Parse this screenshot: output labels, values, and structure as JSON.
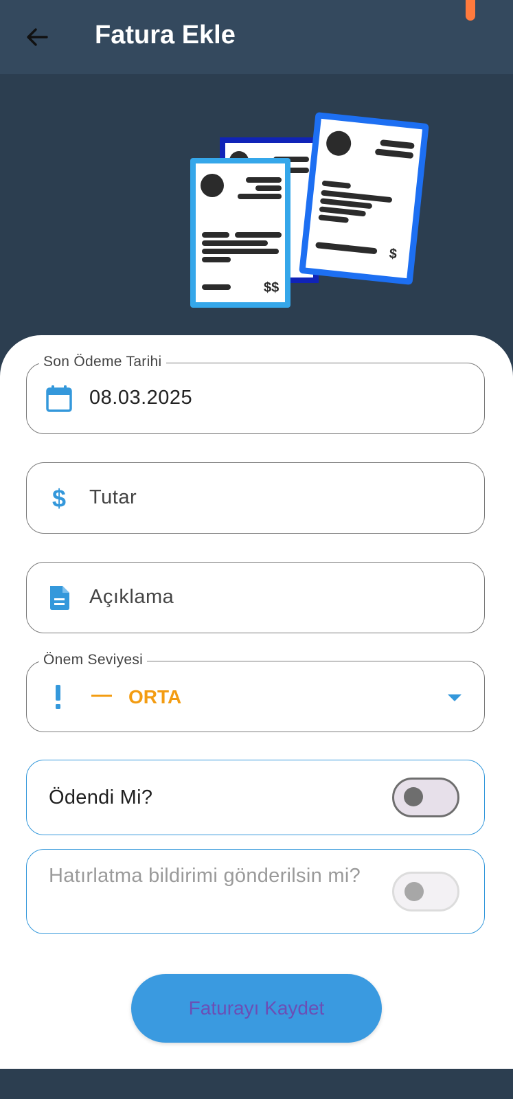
{
  "appbar": {
    "title": "Fatura Ekle",
    "back_icon": "arrow-left-icon"
  },
  "illustration": {
    "back_card_symbol": "$$",
    "left_card_symbol": "$$",
    "right_card_symbol": "$"
  },
  "form": {
    "due_date": {
      "label": "Son Ödeme Tarihi",
      "value": "08.03.2025",
      "icon": "calendar-icon"
    },
    "amount": {
      "placeholder": "Tutar",
      "icon": "dollar-icon"
    },
    "description": {
      "placeholder": "Açıklama",
      "icon": "document-icon"
    },
    "priority": {
      "label": "Önem Seviyesi",
      "value": "ORTA",
      "value_color": "#f39c12",
      "icon": "exclamation-icon",
      "marker": "—",
      "dropdown_icon": "dropdown-arrow-icon"
    },
    "paid": {
      "label": "Ödendi Mi?",
      "on": false
    },
    "reminder": {
      "label": "Hatırlatma bildirimi gönderilsin mi?",
      "on": false,
      "enabled": false
    }
  },
  "save_button": {
    "label": "Faturayı Kaydet"
  },
  "colors": {
    "appbar": "#34495e",
    "background": "#2c3e50",
    "accent": "#3498db",
    "priority_orange": "#f39c12"
  }
}
